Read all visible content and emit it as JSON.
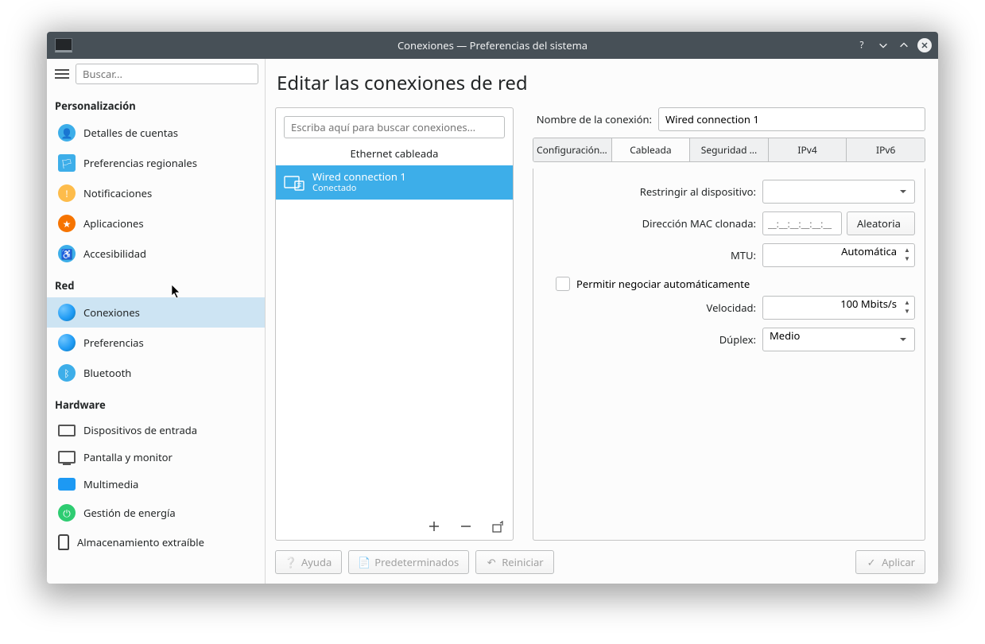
{
  "titlebar": {
    "title": "Conexiones — Preferencias del sistema"
  },
  "sidebar": {
    "search_placeholder": "Buscar...",
    "sections": [
      {
        "title": "Personalización",
        "items": [
          {
            "label": "Detalles de cuentas"
          },
          {
            "label": "Preferencias regionales"
          },
          {
            "label": "Notificaciones"
          },
          {
            "label": "Aplicaciones"
          },
          {
            "label": "Accesibilidad"
          }
        ]
      },
      {
        "title": "Red",
        "items": [
          {
            "label": "Conexiones"
          },
          {
            "label": "Preferencias"
          },
          {
            "label": "Bluetooth"
          }
        ]
      },
      {
        "title": "Hardware",
        "items": [
          {
            "label": "Dispositivos de entrada"
          },
          {
            "label": "Pantalla y monitor"
          },
          {
            "label": "Multimedia"
          },
          {
            "label": "Gestión de energía"
          },
          {
            "label": "Almacenamiento extraíble"
          }
        ]
      }
    ]
  },
  "main": {
    "title": "Editar las conexiones de red",
    "conn_search_placeholder": "Escriba aquí para buscar conexiones...",
    "conn_category": "Ethernet cableada",
    "connection": {
      "name": "Wired connection 1",
      "status": "Conectado"
    },
    "name_label": "Nombre de la conexión:",
    "name_value": "Wired connection 1",
    "tabs": [
      "Configuración g...",
      "Cableada",
      "Seguridad ...",
      "IPv4",
      "IPv6"
    ],
    "form": {
      "restrict_label": "Restringir al dispositivo:",
      "restrict_value": "",
      "mac_label": "Dirección MAC clonada:",
      "mac_placeholder": "__:__:__:__:__:__",
      "random_btn": "Aleatoria",
      "mtu_label": "MTU:",
      "mtu_value": "Automática",
      "autoneg_label": "Permitir negociar automáticamente",
      "speed_label": "Velocidad:",
      "speed_value": "100 Mbits/s",
      "duplex_label": "Dúplex:",
      "duplex_value": "Medio"
    },
    "buttons": {
      "help": "Ayuda",
      "defaults": "Predeterminados",
      "reset": "Reiniciar",
      "apply": "Aplicar"
    }
  }
}
